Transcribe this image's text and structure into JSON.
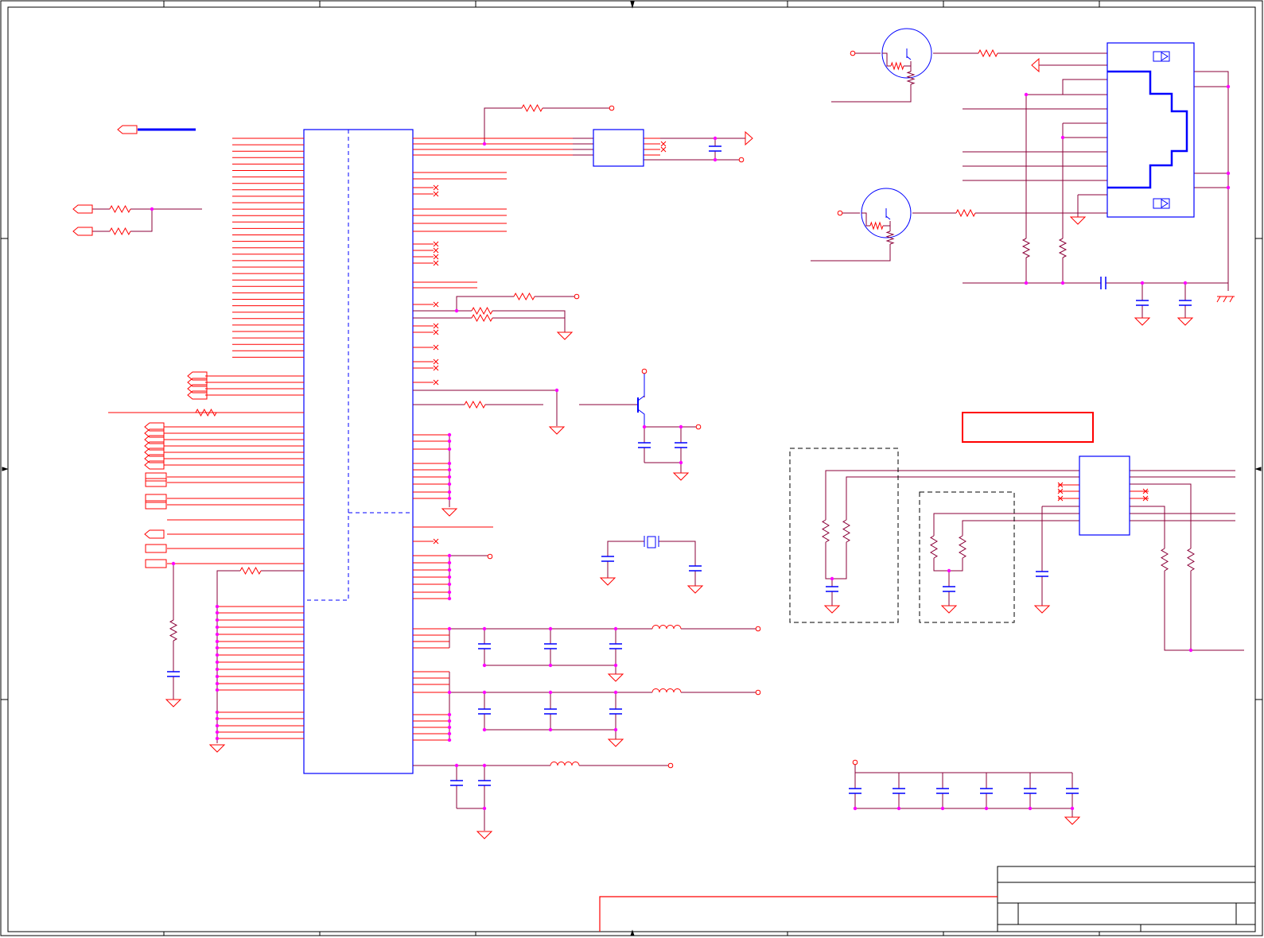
{
  "sheet": {
    "background": "#ffffff",
    "frame_color": "#000000",
    "wire_color": "#8b0038",
    "pin_color": "#ff0000",
    "body_color": "#0000ff",
    "junction_color": "#ff00ff",
    "highlight_color": "#ff0000"
  },
  "labels": {}
}
